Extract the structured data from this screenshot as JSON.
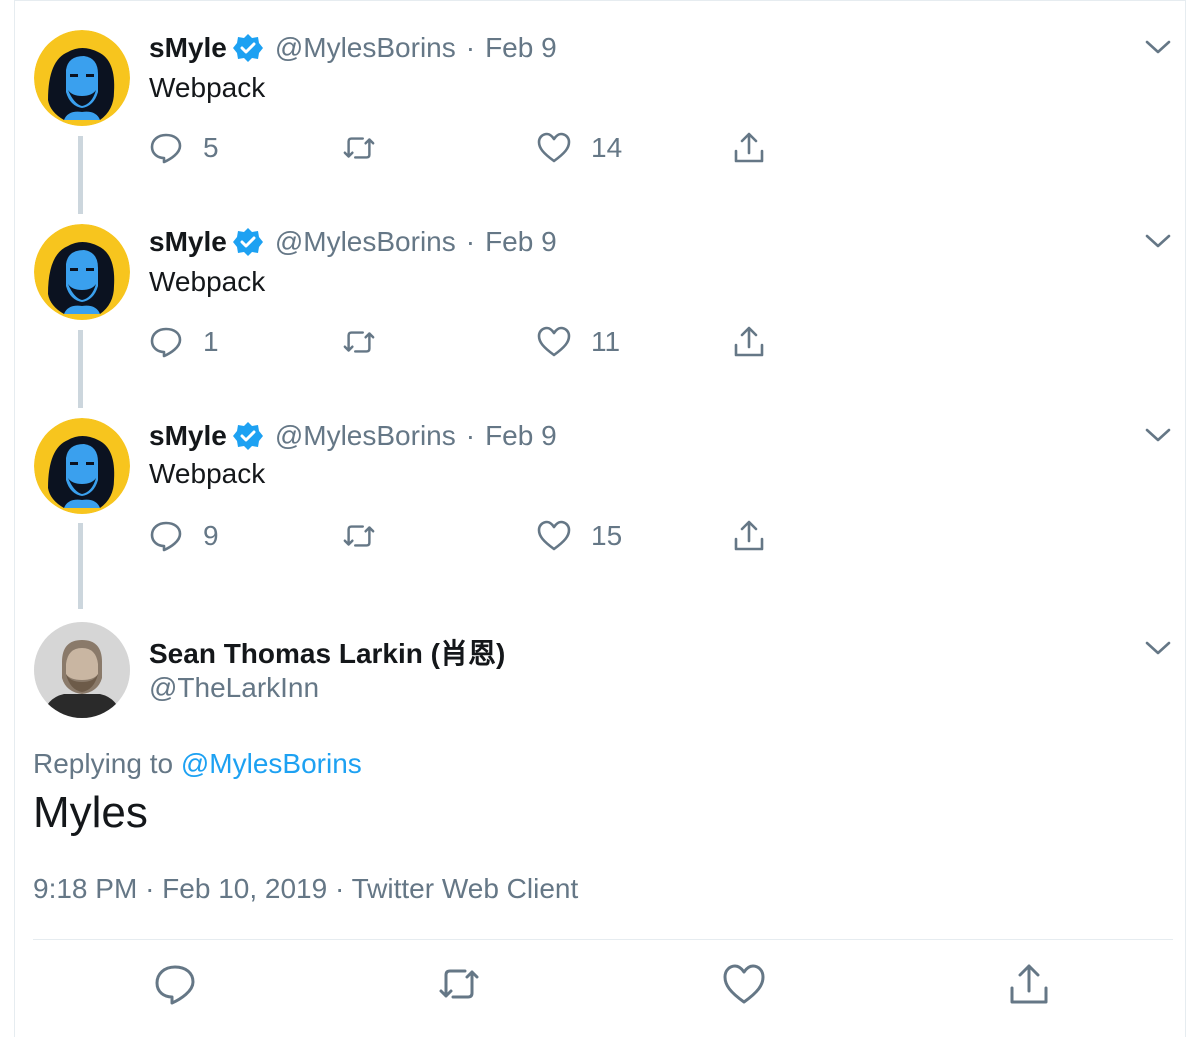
{
  "thread": [
    {
      "name": "sMyle",
      "handle": "@MylesBorins",
      "separator": "·",
      "date": "Feb 9",
      "text": "Webpack",
      "replies": "5",
      "likes": "14"
    },
    {
      "name": "sMyle",
      "handle": "@MylesBorins",
      "separator": "·",
      "date": "Feb 9",
      "text": "Webpack",
      "replies": "1",
      "likes": "11"
    },
    {
      "name": "sMyle",
      "handle": "@MylesBorins",
      "separator": "·",
      "date": "Feb 9",
      "text": "Webpack",
      "replies": "9",
      "likes": "15"
    }
  ],
  "focused": {
    "name": "Sean Thomas Larkin (肖恩)",
    "handle": "@TheLarkInn",
    "replying_prefix": "Replying to",
    "replying_to": "@MylesBorins",
    "text": "Myles",
    "time": "9:18 PM",
    "date": "Feb 10, 2019",
    "client": "Twitter Web Client",
    "separator": "·"
  },
  "icons": {
    "reply": "reply-icon",
    "retweet": "retweet-icon",
    "like": "heart-icon",
    "share": "share-icon",
    "caret": "chevron-down-icon",
    "verified": "verified-badge-icon"
  },
  "colors": {
    "accent": "#1da1f2",
    "muted": "#657786",
    "text": "#14171a",
    "avatar_bg": "#f7c51e",
    "thread_line": "#ccd6dd"
  }
}
